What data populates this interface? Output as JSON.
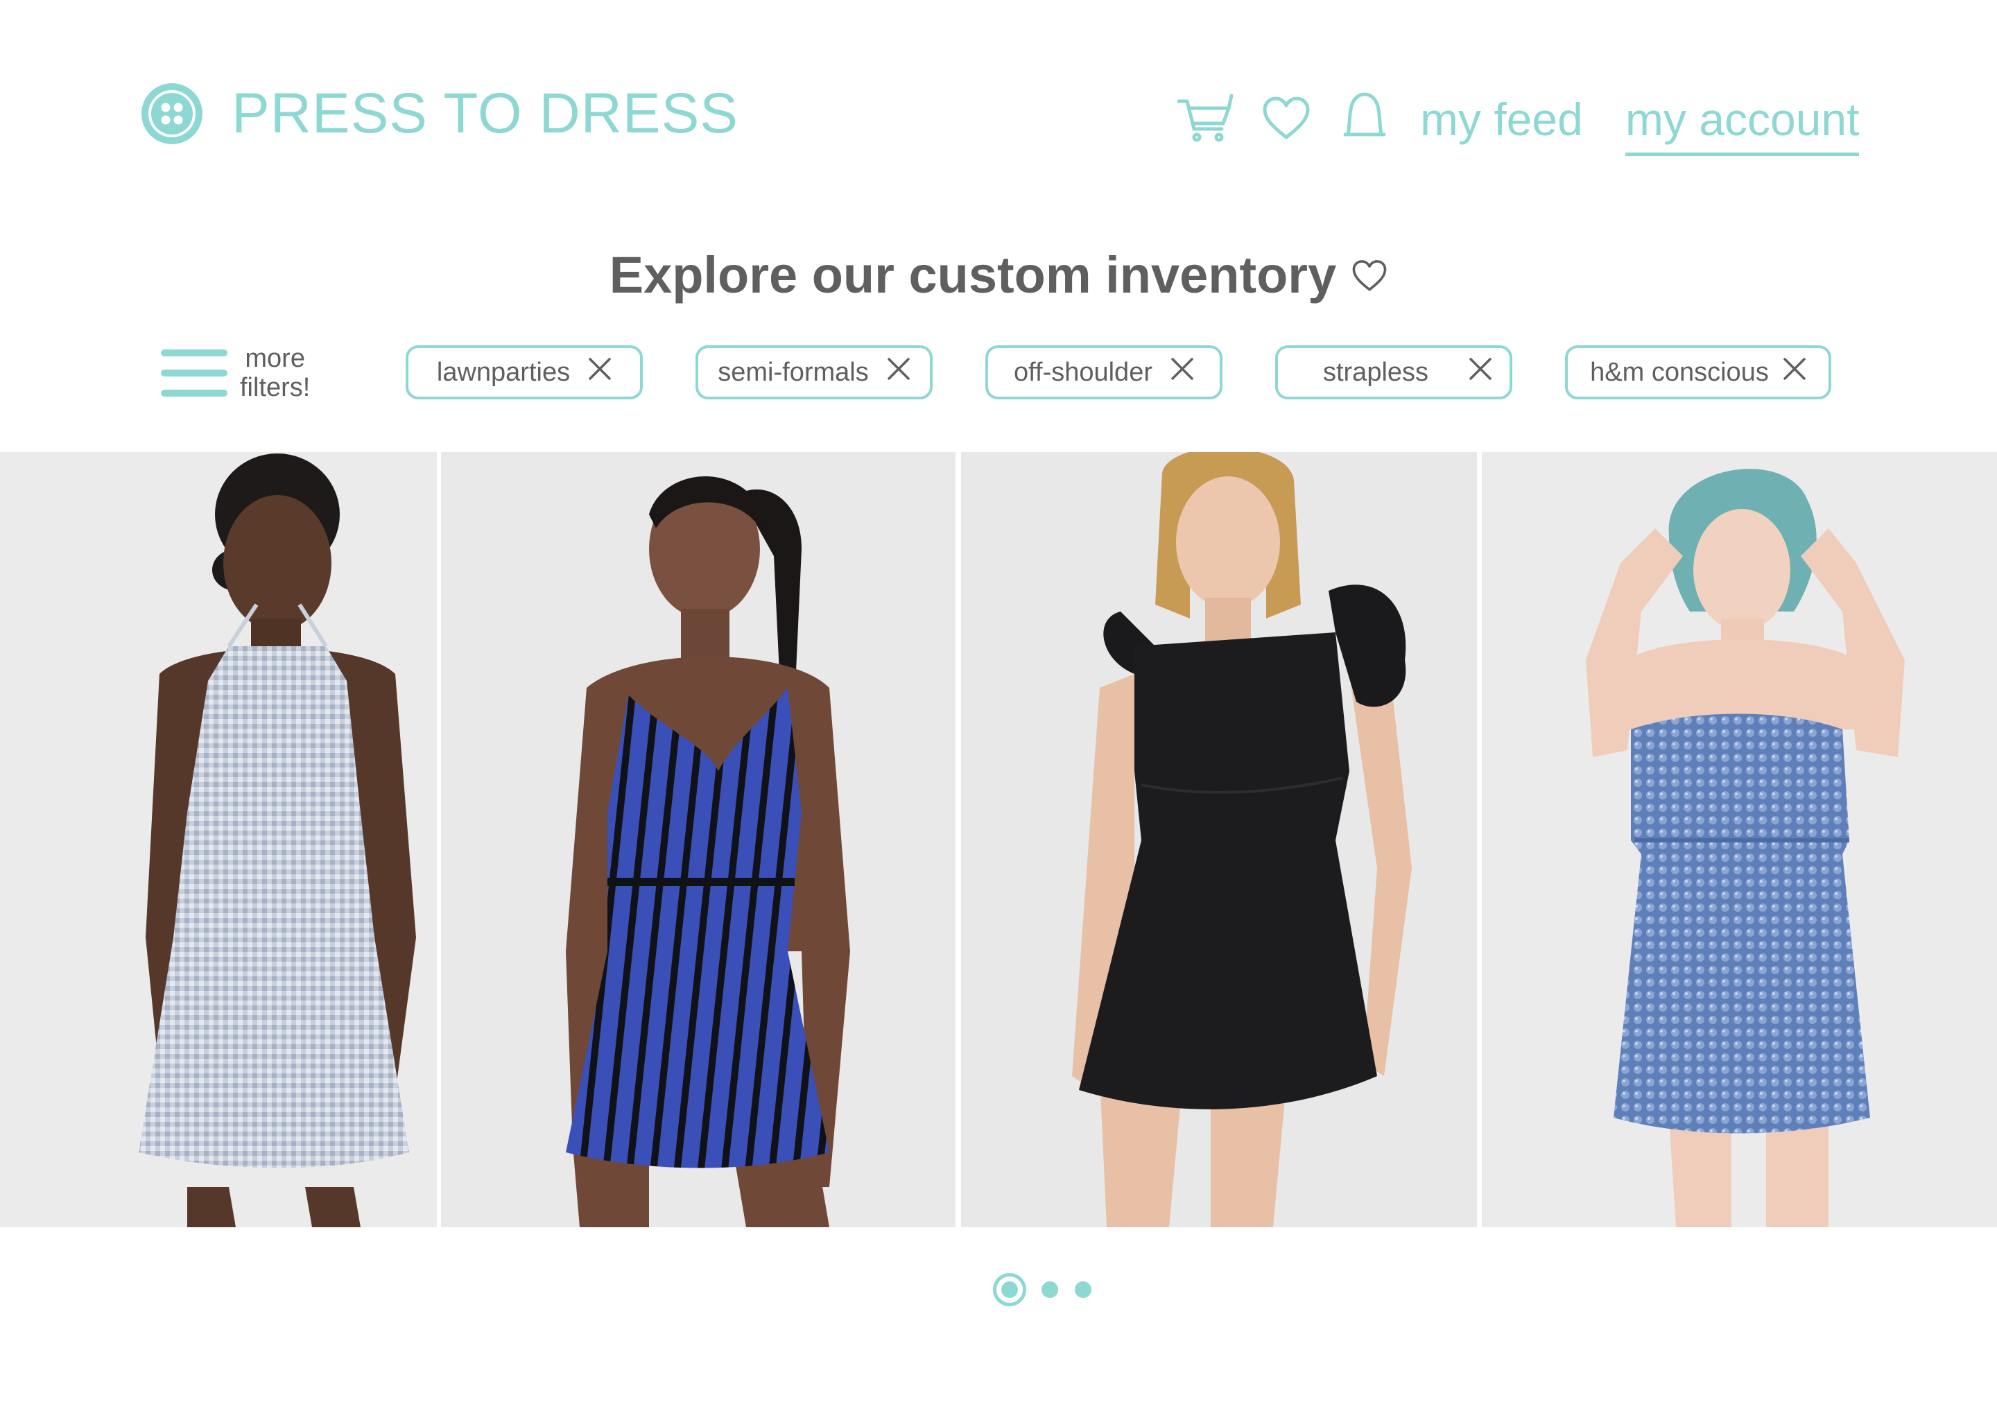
{
  "brand": {
    "name": "PRESS TO DRESS",
    "logo_icon": "button-icon"
  },
  "colors": {
    "accent": "#8dd8d3",
    "text_gray": "#5f5f5f",
    "photo_background": "#ebebec"
  },
  "nav": {
    "icons": [
      "cart-icon",
      "heart-icon",
      "bell-icon"
    ],
    "feed_label": "my feed",
    "account_label": "my account",
    "active": "my account"
  },
  "headline": {
    "text": "Explore our custom inventory",
    "icon": "heart-outline-icon"
  },
  "filters": {
    "more_label_line1": "more",
    "more_label_line2": "filters!",
    "menu_icon": "hamburger-icon",
    "chips": [
      {
        "label": "lawnparties"
      },
      {
        "label": "semi-formals"
      },
      {
        "label": "off-shoulder"
      },
      {
        "label": "strapless"
      },
      {
        "label": "h&m conscious"
      }
    ],
    "remove_icon": "close-icon"
  },
  "products": [
    {
      "description": "Light blue gingham halter mini dress"
    },
    {
      "description": "Blue and black striped wrap slip dress"
    },
    {
      "description": "Black fit-and-flare dress with ruffle straps"
    },
    {
      "description": "Blue sequin strapless mini dress"
    }
  ],
  "pagination": {
    "pages": 3,
    "current": 1
  }
}
